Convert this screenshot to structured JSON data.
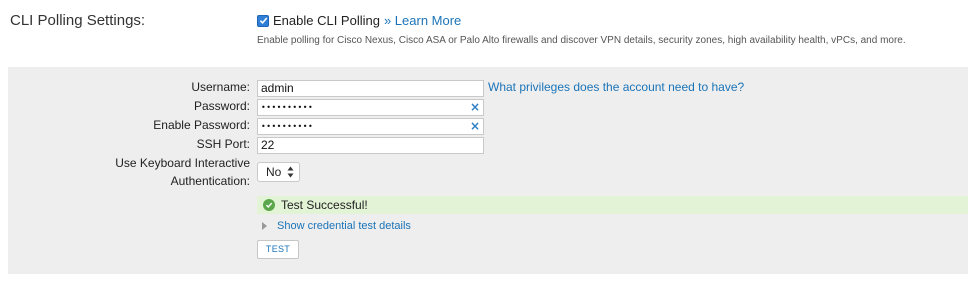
{
  "section": {
    "label": "CLI Polling Settings:",
    "enable_label": "Enable CLI Polling",
    "enable_checked": true,
    "learn_more": "» Learn More",
    "help_text": "Enable polling for Cisco Nexus, Cisco ASA or Palo Alto firewalls and discover VPN details, security zones, high availability health, vPCs, and more."
  },
  "form": {
    "username_label": "Username:",
    "username_value": "admin",
    "privileges_link": "What privileges does the account need to have?",
    "password_label": "Password:",
    "password_value": "••••••••••",
    "enable_password_label": "Enable Password:",
    "enable_password_value": "••••••••••",
    "clear_glyph": "×",
    "ssh_port_label": "SSH Port:",
    "ssh_port_value": "22",
    "keyboard_label_line1": "Use Keyboard Interactive",
    "keyboard_label_line2": "Authentication:",
    "keyboard_value": "No"
  },
  "result": {
    "status_text": "Test Successful!",
    "details_link": "Show credential test details",
    "test_button": "TEST"
  },
  "colors": {
    "accent": "#1b74b8",
    "success_bg": "#e3f4d6",
    "success_icon": "#5ba84c",
    "panel_bg": "#eeeeee"
  }
}
